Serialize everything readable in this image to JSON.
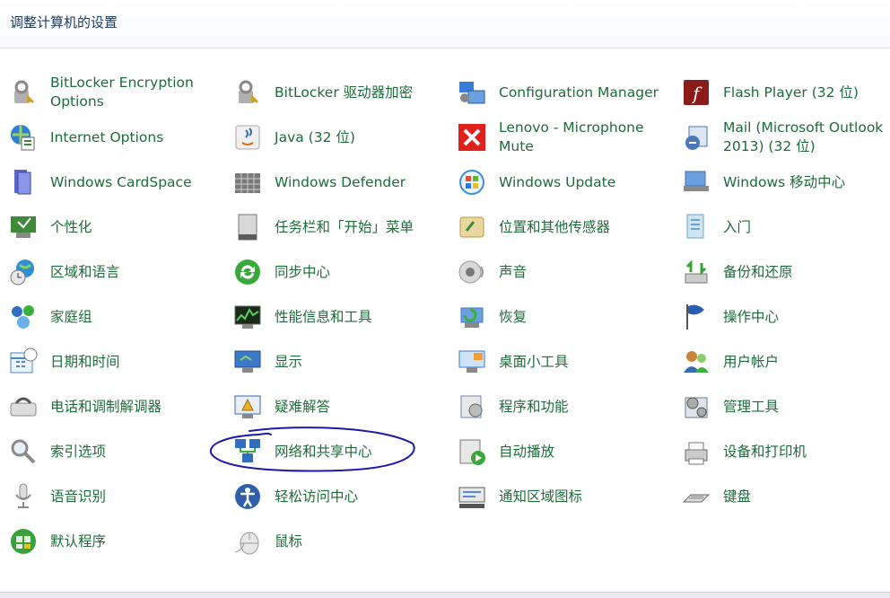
{
  "page": {
    "title": "调整计算机的设置"
  },
  "items": [
    {
      "label": "BitLocker Encryption Options",
      "icon": "bitlocker-key-icon",
      "color": "#c9a227"
    },
    {
      "label": "BitLocker 驱动器加密",
      "icon": "bitlocker-key-icon",
      "color": "#c9a227"
    },
    {
      "label": "Configuration Manager",
      "icon": "configuration-manager-icon",
      "color": "#3a7bd5"
    },
    {
      "label": "Flash Player (32 位)",
      "icon": "flash-player-icon",
      "color": "#8b1a1a"
    },
    {
      "label": "Internet Options",
      "icon": "internet-options-icon",
      "color": "#2f7fd1"
    },
    {
      "label": "Java (32 位)",
      "icon": "java-icon",
      "color": "#d86b1f"
    },
    {
      "label": "Lenovo - Microphone Mute",
      "icon": "microphone-mute-icon",
      "color": "#e0201b"
    },
    {
      "label": "Mail (Microsoft Outlook 2013) (32 位)",
      "icon": "mail-icon",
      "color": "#4a78b8"
    },
    {
      "label": "Windows CardSpace",
      "icon": "cardspace-icon",
      "color": "#5a66c8"
    },
    {
      "label": "Windows Defender",
      "icon": "windows-defender-icon",
      "color": "#7a7a7a"
    },
    {
      "label": "Windows Update",
      "icon": "windows-update-icon",
      "color": "#3a8fd8"
    },
    {
      "label": "Windows 移动中心",
      "icon": "mobility-center-icon",
      "color": "#3c6fa8"
    },
    {
      "label": "个性化",
      "icon": "personalization-icon",
      "color": "#3e8a3a"
    },
    {
      "label": "任务栏和「开始」菜单",
      "icon": "taskbar-icon",
      "color": "#5a5a5a"
    },
    {
      "label": "位置和其他传感器",
      "icon": "location-sensors-icon",
      "color": "#b79a3c"
    },
    {
      "label": "入门",
      "icon": "getting-started-icon",
      "color": "#6aa6c8"
    },
    {
      "label": "区域和语言",
      "icon": "region-language-icon",
      "color": "#2f8fd1"
    },
    {
      "label": "同步中心",
      "icon": "sync-center-icon",
      "color": "#38a83a"
    },
    {
      "label": "声音",
      "icon": "sound-icon",
      "color": "#9a9a9a"
    },
    {
      "label": "备份和还原",
      "icon": "backup-restore-icon",
      "color": "#3aa03a"
    },
    {
      "label": "家庭组",
      "icon": "homegroup-icon",
      "color": "#2f6fc1"
    },
    {
      "label": "性能信息和工具",
      "icon": "performance-icon",
      "color": "#3a8a3a"
    },
    {
      "label": "恢复",
      "icon": "recovery-icon",
      "color": "#3a78c8"
    },
    {
      "label": "操作中心",
      "icon": "action-center-flag-icon",
      "color": "#2a5fb0"
    },
    {
      "label": "日期和时间",
      "icon": "date-time-icon",
      "color": "#4a86c8"
    },
    {
      "label": "显示",
      "icon": "display-icon",
      "color": "#3a7ac8"
    },
    {
      "label": "桌面小工具",
      "icon": "desktop-gadgets-icon",
      "color": "#3a7ac8"
    },
    {
      "label": "用户帐户",
      "icon": "user-accounts-icon",
      "color": "#c8863a"
    },
    {
      "label": "电话和调制解调器",
      "icon": "phone-modem-icon",
      "color": "#8a8a8a"
    },
    {
      "label": "疑难解答",
      "icon": "troubleshooting-icon",
      "color": "#3a6aa8"
    },
    {
      "label": "程序和功能",
      "icon": "programs-features-icon",
      "color": "#6a8ab8"
    },
    {
      "label": "管理工具",
      "icon": "administrative-tools-icon",
      "color": "#6a7a8a"
    },
    {
      "label": "索引选项",
      "icon": "indexing-options-icon",
      "color": "#8a8a8a"
    },
    {
      "label": "网络和共享中心",
      "icon": "network-sharing-icon",
      "color": "#2f6fc1"
    },
    {
      "label": "自动播放",
      "icon": "autoplay-icon",
      "color": "#38a83a"
    },
    {
      "label": "设备和打印机",
      "icon": "devices-printers-icon",
      "color": "#6a6a6a"
    },
    {
      "label": "语音识别",
      "icon": "speech-recognition-icon",
      "color": "#8a8a8a"
    },
    {
      "label": "轻松访问中心",
      "icon": "ease-of-access-icon",
      "color": "#2f5fa8"
    },
    {
      "label": "通知区域图标",
      "icon": "notification-area-icon",
      "color": "#5a5a5a"
    },
    {
      "label": "键盘",
      "icon": "keyboard-icon",
      "color": "#6a6a6a"
    },
    {
      "label": "默认程序",
      "icon": "default-programs-icon",
      "color": "#3aa03a"
    },
    {
      "label": "鼠标",
      "icon": "mouse-icon",
      "color": "#9a9a9a"
    }
  ],
  "annotation": {
    "color": "#1a1aa8"
  }
}
